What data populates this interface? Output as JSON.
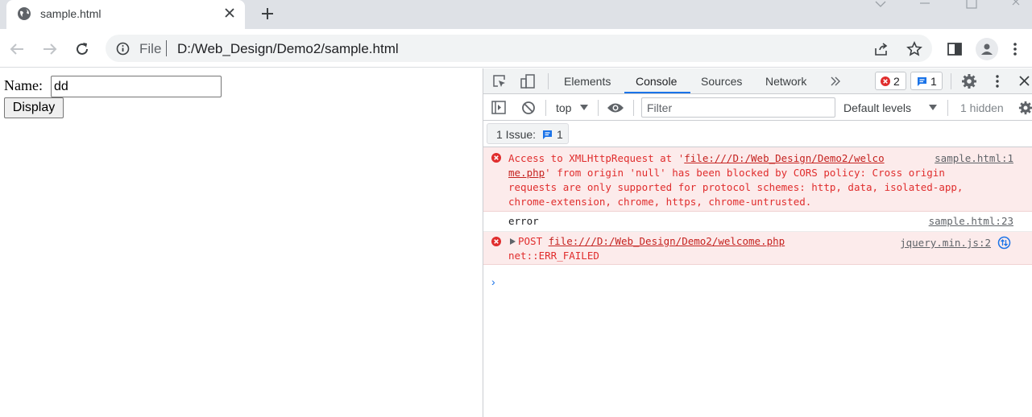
{
  "browser": {
    "tab_title": "sample.html",
    "scheme_label": "File",
    "url": "D:/Web_Design/Demo2/sample.html"
  },
  "page": {
    "name_label": "Name:",
    "name_value": "dd",
    "display_button": "Display"
  },
  "devtools": {
    "tabs": [
      "Elements",
      "Console",
      "Sources",
      "Network"
    ],
    "active_tab": "Console",
    "error_count": "2",
    "message_count": "1",
    "context": "top",
    "filter_placeholder": "Filter",
    "levels": "Default levels",
    "hidden": "1 hidden",
    "issues_label": "1 Issue:",
    "issues_count": "1"
  },
  "console": {
    "cors_error": {
      "line1_a": "Access to XMLHttpRequest at '",
      "line1_link": "file:///D:/Web_Design/Demo2/welco",
      "line2_link": "me.php",
      "line2_b": "' from origin 'null' has been blocked by CORS policy: Cross origin",
      "line3": "requests are only supported for protocol schemes: http, data, isolated-app,",
      "line4": "chrome-extension, chrome, https, chrome-untrusted.",
      "source_line1": "sample.html:1"
    },
    "log": {
      "text": "error",
      "source": "sample.html:23"
    },
    "net_error": {
      "method": "POST",
      "url": "file:///D:/Web_Design/Demo2/welcome.php",
      "status": "net::ERR_FAILED",
      "source": "jquery.min.js:2"
    },
    "prompt": "›"
  },
  "colors": {
    "accent": "#1a73e8",
    "error": "#e02d2d",
    "error_bg": "#fcebeb"
  }
}
